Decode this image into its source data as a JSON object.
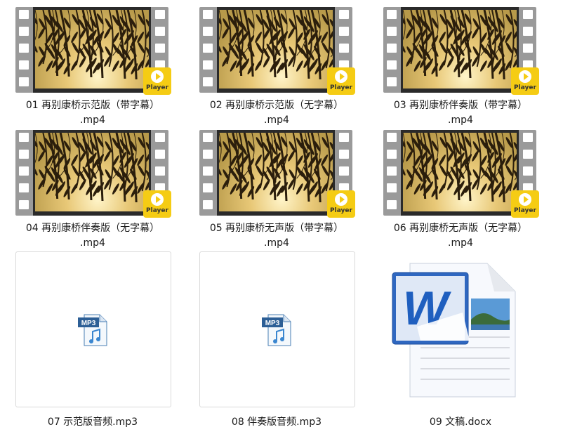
{
  "files": [
    {
      "name_line1": "01 再别康桥示范版（带字幕）",
      "name_line2": ".mp4",
      "type": "video",
      "badge": "Player"
    },
    {
      "name_line1": "02 再别康桥示范版（无字幕）",
      "name_line2": ".mp4",
      "type": "video",
      "badge": "Player"
    },
    {
      "name_line1": "03 再别康桥伴奏版（带字幕）",
      "name_line2": ".mp4",
      "type": "video",
      "badge": "Player"
    },
    {
      "name_line1": "04 再别康桥伴奏版（无字幕）",
      "name_line2": ".mp4",
      "type": "video",
      "badge": "Player"
    },
    {
      "name_line1": "05 再别康桥无声版（带字幕）",
      "name_line2": ".mp4",
      "type": "video",
      "badge": "Player"
    },
    {
      "name_line1": "06 再别康桥无声版（无字幕）",
      "name_line2": ".mp4",
      "type": "video",
      "badge": "Player"
    },
    {
      "name_line1": "07 示范版音频.mp3",
      "type": "audio",
      "icon_text": "MP3",
      "icon": "mp3-file-icon"
    },
    {
      "name_line1": "08 伴奏版音频.mp3",
      "type": "audio",
      "icon_text": "MP3",
      "icon": "mp3-file-icon"
    },
    {
      "name_line1": "09 文稿.docx",
      "type": "document",
      "icon": "word-document-icon"
    }
  ],
  "colors": {
    "badge": "#f5cc14",
    "word_blue": "#1f5fbf"
  }
}
